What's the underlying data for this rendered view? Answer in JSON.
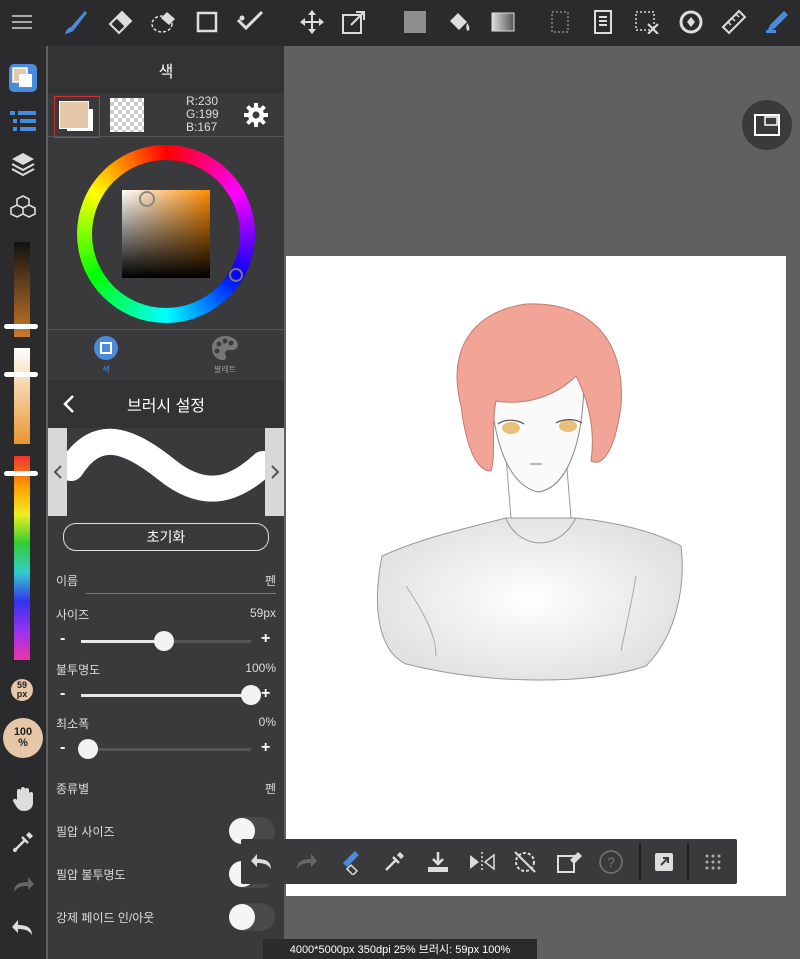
{
  "color_panel": {
    "title": "색",
    "rgb_r": "R:230",
    "rgb_g": "G:199",
    "rgb_b": "B:167",
    "tab_color": "색",
    "tab_palette": "팔레트",
    "main_color": "#e6c7a7",
    "accent": "#4b8bdc"
  },
  "left_bar": {
    "brush_size_top": "59",
    "brush_size_bottom": "px",
    "opacity_top": "100",
    "opacity_bottom": "%"
  },
  "brush_settings": {
    "title": "브러시 설정",
    "reset_label": "초기화",
    "name_label": "이름",
    "name_value": "펜",
    "size_label": "사이즈",
    "size_value": "59px",
    "size_fraction": 0.49,
    "opacity_label": "불투명도",
    "opacity_value": "100%",
    "opacity_fraction": 1.0,
    "min_width_label": "최소폭",
    "min_width_value": "0%",
    "min_width_fraction": 0.04,
    "type_label": "종류별",
    "type_value": "펜",
    "pressure_size_label": "필압 사이즈",
    "pressure_opacity_label": "필압 불투명도",
    "fade_label": "강제 페이드 인/아웃",
    "minus": "-",
    "plus": "+"
  },
  "status_bar": {
    "text": "4000*5000px 350dpi 25% 브러시: 59px 100%"
  },
  "icons": {
    "top": [
      "menu-icon",
      "brush-icon",
      "eraser-icon",
      "lasso-eraser-icon",
      "rect-select-icon",
      "check-pen-icon",
      "move-icon",
      "transform-icon",
      "fill-color-icon",
      "bucket-icon",
      "gradient-icon",
      "select-dashed-icon",
      "layer-doc-icon",
      "select-clear-icon",
      "rotate-icon",
      "ruler-icon",
      "pen-active-icon"
    ],
    "bottom": [
      "undo-icon",
      "redo-icon",
      "eraser-brush-icon",
      "eyedropper-icon",
      "save-icon",
      "flip-icon",
      "rotate-reset-icon",
      "clear-icon",
      "help-icon",
      "expand-icon",
      "grid-icon"
    ]
  }
}
